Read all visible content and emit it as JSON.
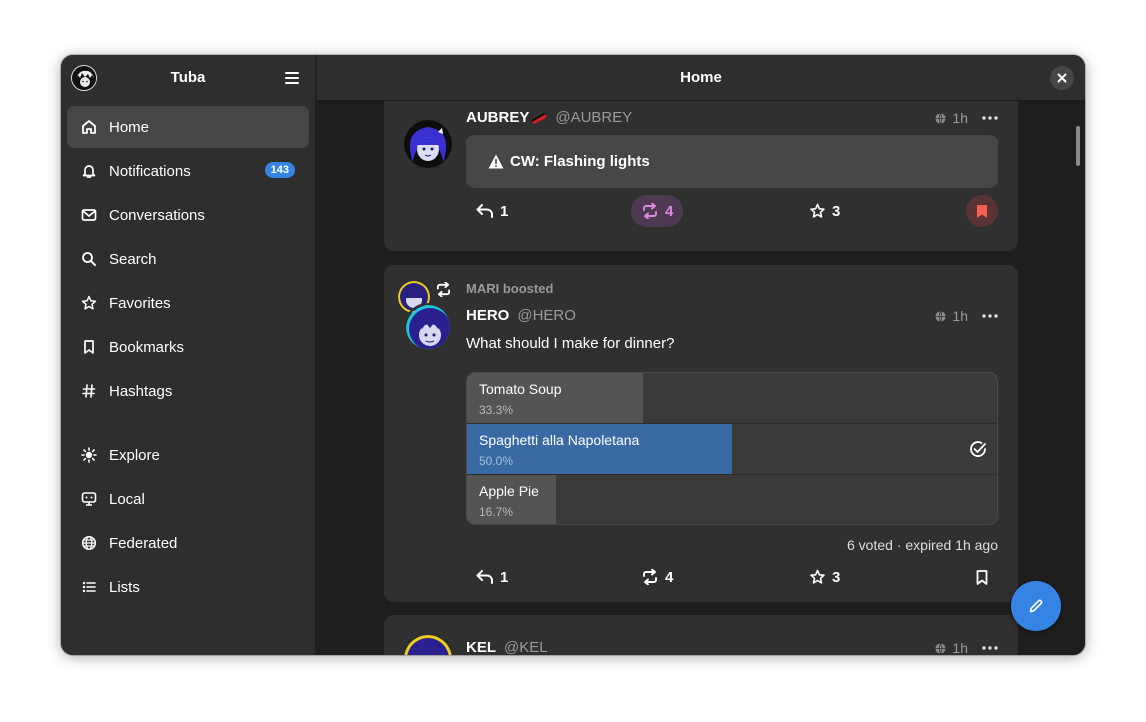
{
  "sidebar": {
    "title": "Tuba",
    "items": [
      {
        "label": "Home",
        "icon": "home-icon",
        "active": true
      },
      {
        "label": "Notifications",
        "icon": "bell-icon",
        "badge": "143"
      },
      {
        "label": "Conversations",
        "icon": "mail-icon"
      },
      {
        "label": "Search",
        "icon": "search-icon"
      },
      {
        "label": "Favorites",
        "icon": "star-icon"
      },
      {
        "label": "Bookmarks",
        "icon": "bookmark-icon"
      },
      {
        "label": "Hashtags",
        "icon": "hashtag-icon"
      },
      {
        "label": "Explore",
        "icon": "explore-icon"
      },
      {
        "label": "Local",
        "icon": "local-icon"
      },
      {
        "label": "Federated",
        "icon": "globe-icon"
      },
      {
        "label": "Lists",
        "icon": "list-icon"
      }
    ]
  },
  "header": {
    "title": "Home"
  },
  "posts": [
    {
      "display_name": "AUBREY",
      "handle": "@AUBREY",
      "time": "1h",
      "cw": "CW: Flashing lights",
      "replies": "1",
      "boosts": "4",
      "favorites": "3",
      "boosted_active": true,
      "bookmarked": true
    },
    {
      "boosted_by": "MARI boosted",
      "display_name": "HERO",
      "handle": "@HERO",
      "time": "1h",
      "content": "What should I make for dinner?",
      "poll": {
        "options": [
          {
            "label": "Tomato Soup",
            "percent": "33.3%",
            "value": 33.3
          },
          {
            "label": "Spaghetti alla Napoletana",
            "percent": "50.0%",
            "value": 50.0,
            "voted": true
          },
          {
            "label": "Apple Pie",
            "percent": "16.7%",
            "value": 16.7
          }
        ],
        "info": "6 voted · expired 1h ago"
      },
      "replies": "1",
      "boosts": "4",
      "favorites": "3"
    },
    {
      "display_name": "KEL",
      "handle": "@KEL",
      "time": "1h"
    }
  ],
  "colors": {
    "accent": "#3584e4",
    "boost_active": "#c061cb",
    "bookmark_active": "#f66151",
    "poll_voted": "#3a6aa3"
  }
}
